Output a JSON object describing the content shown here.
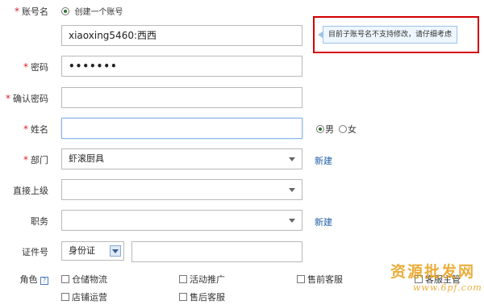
{
  "form": {
    "account": {
      "label": "账号名",
      "radio_label": "创建一个账号",
      "value": "xiaoxing5460:西西"
    },
    "tip": {
      "text": "目前子账号名不支持修改，请仔细考虑"
    },
    "password": {
      "label": "密码",
      "value": "•••••••"
    },
    "confirm": {
      "label": "确认密码",
      "value": ""
    },
    "name": {
      "label": "姓名",
      "value": "",
      "gender_male": "男",
      "gender_female": "女"
    },
    "dept": {
      "label": "部门",
      "value": "虾滚厨具",
      "new_link": "新建"
    },
    "superior": {
      "label": "直接上级",
      "value": ""
    },
    "position": {
      "label": "职务",
      "value": "",
      "new_link": "新建"
    },
    "id": {
      "label": "证件号",
      "type_value": "身份证",
      "value": ""
    },
    "role": {
      "label": "角色",
      "help_icon": "?",
      "options": [
        "仓储物流",
        "活动推广",
        "售前客服",
        "客服主管",
        "店铺运营",
        "售后客服"
      ]
    }
  },
  "watermark": {
    "title": "资源批发网",
    "url": "www.6pf.com"
  },
  "colors": {
    "required": "#d9242b",
    "link": "#1f5fa8",
    "tip_border": "#d40000",
    "watermark": "#e8a01a"
  }
}
